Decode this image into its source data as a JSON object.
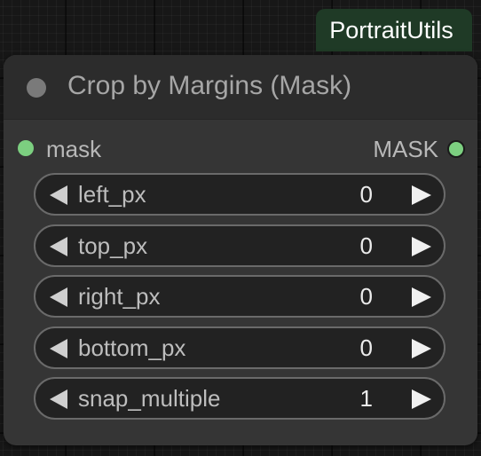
{
  "badge": {
    "label": "PortraitUtils",
    "color": "#1f3a26"
  },
  "node": {
    "title": "Crop by Margins (Mask)",
    "input": {
      "label": "mask",
      "color": "#7ccf80"
    },
    "output": {
      "label": "MASK",
      "color": "#7ccf80"
    },
    "widgets": [
      {
        "label": "left_px",
        "value": "0"
      },
      {
        "label": "top_px",
        "value": "0"
      },
      {
        "label": "right_px",
        "value": "0"
      },
      {
        "label": "bottom_px",
        "value": "0"
      },
      {
        "label": "snap_multiple",
        "value": "1"
      }
    ]
  },
  "icons": {
    "collapse": "collapse-dot-icon",
    "decrement": "triangle-left-icon",
    "increment": "triangle-right-icon",
    "slot": "circle-slot-icon"
  }
}
